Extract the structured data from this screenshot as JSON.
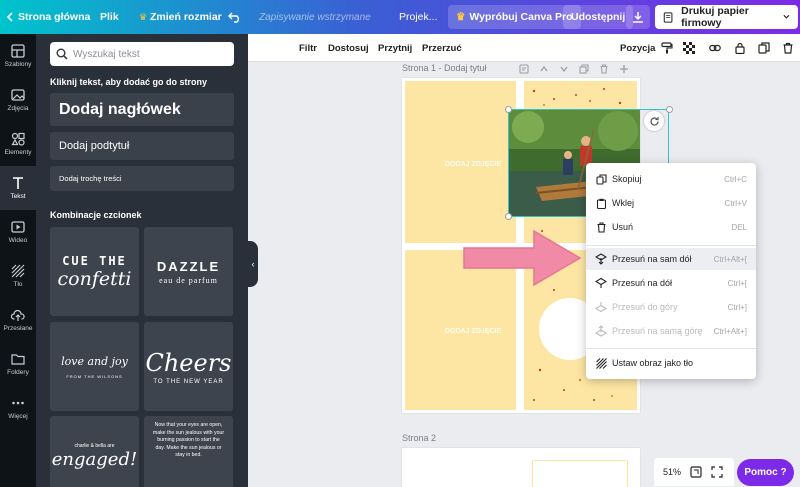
{
  "topbar": {
    "home_label": "Strona główna",
    "file_label": "Plik",
    "resize_label": "Zmień rozmiar",
    "save_status": "Zapisywanie wstrzymane",
    "project_label": "Projek...",
    "try_pro_label": "Wypróbuj Canva Pro",
    "share_label": "Udostępnij",
    "print_label": "Drukuj papier firmowy"
  },
  "rail": {
    "items": [
      {
        "label": "Szablony",
        "icon": "template-icon"
      },
      {
        "label": "Zdjęcia",
        "icon": "photo-icon"
      },
      {
        "label": "Elementy",
        "icon": "elements-icon"
      },
      {
        "label": "Tekst",
        "icon": "text-icon"
      },
      {
        "label": "Wideo",
        "icon": "video-icon"
      },
      {
        "label": "Tło",
        "icon": "background-icon"
      },
      {
        "label": "Przesłane",
        "icon": "upload-icon"
      },
      {
        "label": "Foldery",
        "icon": "folder-icon"
      },
      {
        "label": "Więcej",
        "icon": "more-icon"
      }
    ]
  },
  "panel": {
    "search_placeholder": "Wyszukaj tekst",
    "click_hint": "Kliknij tekst, aby dodać go do strony",
    "add_heading": "Dodaj nagłówek",
    "add_subheading": "Dodaj podtytuł",
    "add_body": "Dodaj trochę treści",
    "combos_title": "Kombinacje czcionek",
    "combos": [
      {
        "line1": "CUE THE",
        "line2": "confetti"
      },
      {
        "line1": "DAZZLE",
        "line2": "eau de parfum"
      },
      {
        "line1": "love and joy",
        "line2": "FROM THE WILSONS"
      },
      {
        "line1": "Cheers",
        "line2": "TO THE NEW YEAR"
      },
      {
        "line1": "charlie & bella are",
        "line2": "engaged!"
      },
      {
        "line1": "Now that your eyes are open, make the sun jealous with your burning passion to start the day. Make the sun jealous or stay in bed.",
        "line2": ""
      }
    ]
  },
  "ctxbar": {
    "filter": "Filtr",
    "adjust": "Dostosuj",
    "crop": "Przytnij",
    "flip": "Przerzuć",
    "position": "Pozycja"
  },
  "canvas": {
    "page1_title": "Strona 1 - Dodaj tytuł",
    "page2_title": "Strona 2",
    "cell_label": "DODAJ ZDJĘCIE"
  },
  "context_menu": {
    "items": [
      {
        "label": "Skopiuj",
        "shortcut": "Ctrl+C",
        "icon": "copy-icon",
        "disabled": false
      },
      {
        "label": "Wklej",
        "shortcut": "Ctrl+V",
        "icon": "paste-icon",
        "disabled": false
      },
      {
        "label": "Usuń",
        "shortcut": "DEL",
        "icon": "trash-icon",
        "disabled": false
      },
      {
        "label": "Przesuń na sam dół",
        "shortcut": "Ctrl+Alt+[",
        "icon": "send-to-back-icon",
        "disabled": false
      },
      {
        "label": "Przesuń na dół",
        "shortcut": "Ctrl+[",
        "icon": "send-backward-icon",
        "disabled": false
      },
      {
        "label": "Przesuń do góry",
        "shortcut": "Ctrl+]",
        "icon": "bring-forward-icon",
        "disabled": true
      },
      {
        "label": "Przesuń na samą górę",
        "shortcut": "Ctrl+Alt+]",
        "icon": "bring-to-front-icon",
        "disabled": true
      },
      {
        "label": "Ustaw obraz jako tło",
        "shortcut": "",
        "icon": "set-background-icon",
        "disabled": false
      }
    ]
  },
  "bottom": {
    "zoom": "51%",
    "help_label": "Pomoc ?"
  },
  "colors": {
    "accent_purple": "#7d2ae8",
    "accent_teal": "#00c4cc",
    "arrow_pink": "#f08aa6",
    "cell_yellow": "#fde6a4"
  }
}
